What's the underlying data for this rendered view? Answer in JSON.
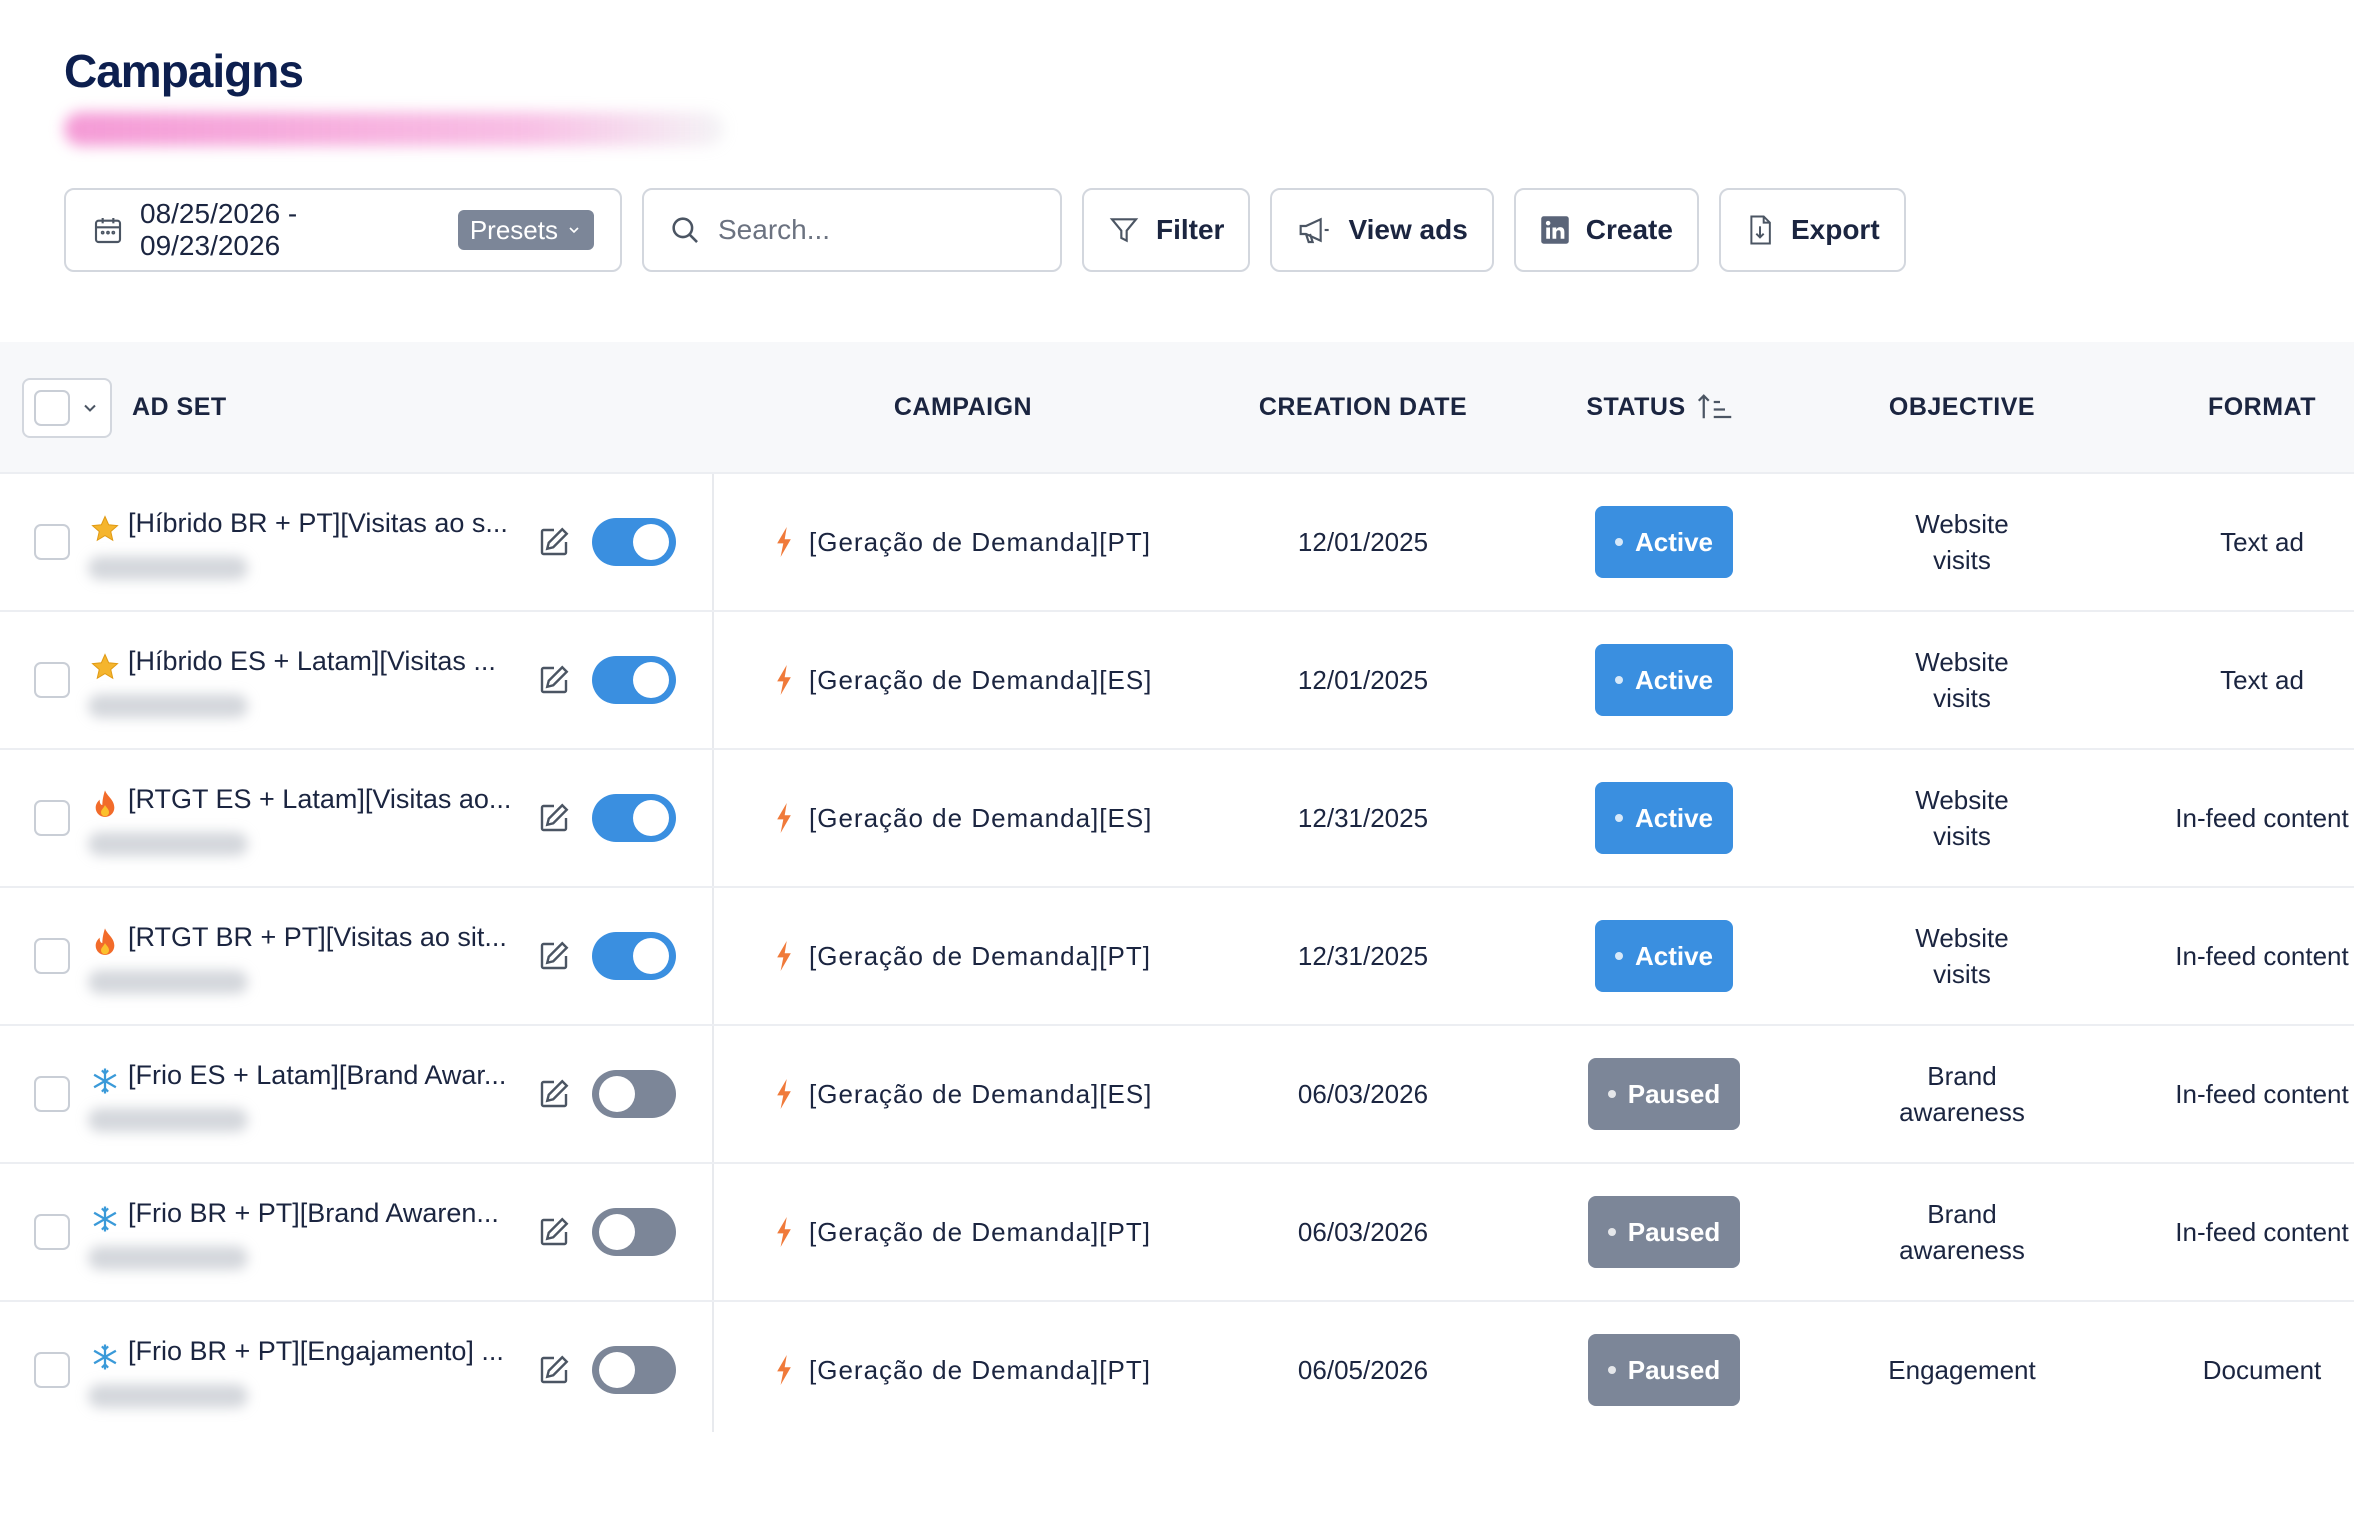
{
  "page": {
    "title": "Campaigns"
  },
  "toolbar": {
    "date_range": "08/25/2026 - 09/23/2026",
    "presets_label": "Presets",
    "search_placeholder": "Search...",
    "filter_label": "Filter",
    "view_ads_label": "View ads",
    "create_label": "Create",
    "export_label": "Export"
  },
  "table": {
    "headers": {
      "ad_set": "AD SET",
      "campaign": "CAMPAIGN",
      "creation_date": "CREATION DATE",
      "status": "STATUS",
      "objective": "OBJECTIVE",
      "format": "FORMAT"
    },
    "rows": [
      {
        "emoji": "star",
        "ad_set": "[Híbrido BR + PT][Visitas ao s...",
        "enabled": true,
        "campaign": "[Geração de Demanda][PT]",
        "creation_date": "12/01/2025",
        "status": "Active",
        "objective": "Website visits",
        "format": "Text ad"
      },
      {
        "emoji": "star",
        "ad_set": "[Híbrido ES + Latam][Visitas ...",
        "enabled": true,
        "campaign": "[Geração de Demanda][ES]",
        "creation_date": "12/01/2025",
        "status": "Active",
        "objective": "Website visits",
        "format": "Text ad"
      },
      {
        "emoji": "fire",
        "ad_set": "[RTGT ES + Latam][Visitas ao...",
        "enabled": true,
        "campaign": "[Geração de Demanda][ES]",
        "creation_date": "12/31/2025",
        "status": "Active",
        "objective": "Website visits",
        "format": "In-feed content"
      },
      {
        "emoji": "fire",
        "ad_set": "[RTGT BR + PT][Visitas ao sit...",
        "enabled": true,
        "campaign": "[Geração de Demanda][PT]",
        "creation_date": "12/31/2025",
        "status": "Active",
        "objective": "Website visits",
        "format": "In-feed content"
      },
      {
        "emoji": "snowflake",
        "ad_set": "[Frio ES + Latam][Brand Awar...",
        "enabled": false,
        "campaign": "[Geração de Demanda][ES]",
        "creation_date": "06/03/2026",
        "status": "Paused",
        "objective": "Brand awareness",
        "format": "In-feed content"
      },
      {
        "emoji": "snowflake",
        "ad_set": "[Frio BR + PT][Brand Awaren...",
        "enabled": false,
        "campaign": "[Geração de Demanda][PT]",
        "creation_date": "06/03/2026",
        "status": "Paused",
        "objective": "Brand awareness",
        "format": "In-feed content"
      },
      {
        "emoji": "snowflake",
        "ad_set": "[Frio BR + PT][Engajamento] ...",
        "enabled": false,
        "campaign": "[Geração de Demanda][PT]",
        "creation_date": "06/05/2026",
        "status": "Paused",
        "objective": "Engagement",
        "format": "Document"
      }
    ]
  },
  "colors": {
    "title": "#0d1f4f",
    "active": "#3a8fe0",
    "paused": "#7c8698",
    "bolt": "#f07a3a"
  }
}
